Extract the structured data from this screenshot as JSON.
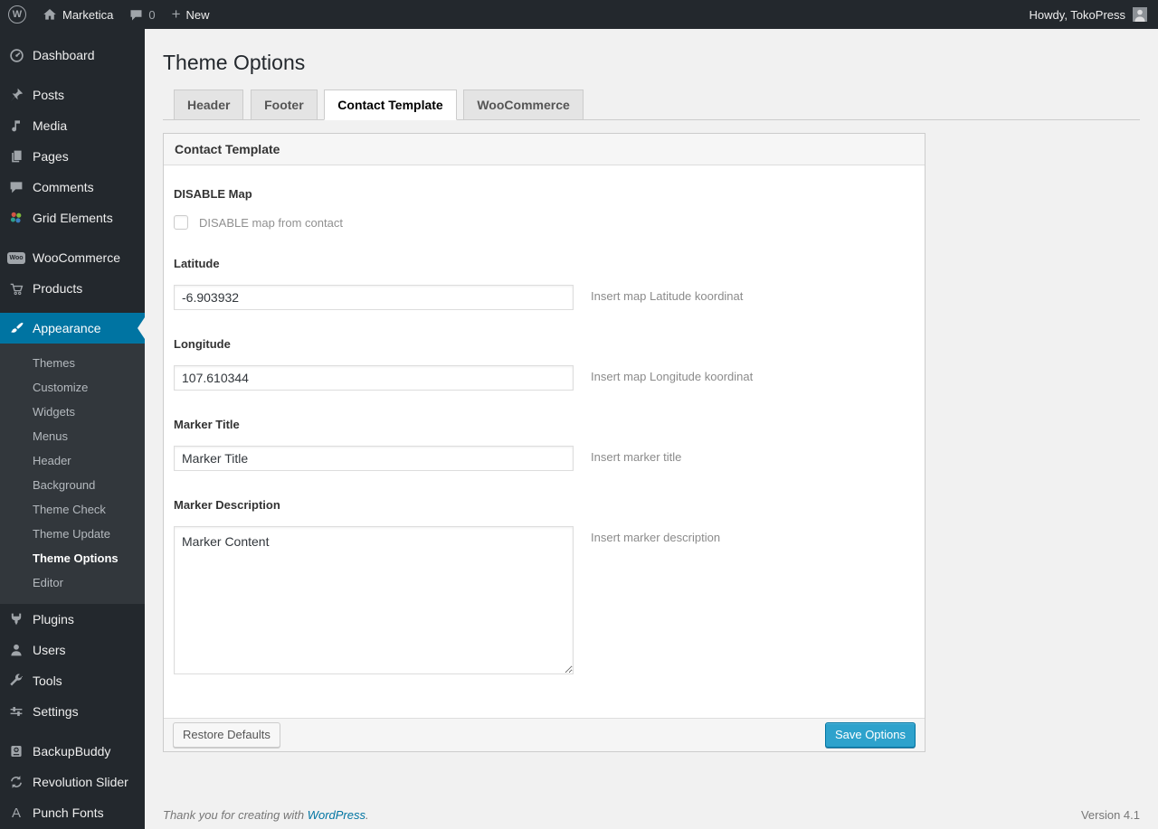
{
  "admin_bar": {
    "site_name": "Marketica",
    "comment_count": "0",
    "new_label": "New",
    "howdy": "Howdy, TokoPress"
  },
  "icons": {
    "wordpress_logo_letter": "W",
    "new_plus": "+",
    "woocommerce_badge": "Woo",
    "punch_fonts_letter": "A"
  },
  "sidebar": {
    "items": [
      {
        "label": "Dashboard"
      },
      {
        "label": "Posts"
      },
      {
        "label": "Media"
      },
      {
        "label": "Pages"
      },
      {
        "label": "Comments"
      },
      {
        "label": "Grid Elements"
      },
      {
        "label": "WooCommerce"
      },
      {
        "label": "Products"
      },
      {
        "label": "Appearance"
      },
      {
        "label": "Plugins"
      },
      {
        "label": "Users"
      },
      {
        "label": "Tools"
      },
      {
        "label": "Settings"
      },
      {
        "label": "BackupBuddy"
      },
      {
        "label": "Revolution Slider"
      },
      {
        "label": "Punch Fonts"
      }
    ],
    "appearance_submenu": [
      "Themes",
      "Customize",
      "Widgets",
      "Menus",
      "Header",
      "Background",
      "Theme Check",
      "Theme Update",
      "Theme Options",
      "Editor"
    ],
    "current_item": "Appearance",
    "current_submenu_item": "Theme Options"
  },
  "page": {
    "title": "Theme Options",
    "tabs": [
      {
        "label": "Header",
        "active": false
      },
      {
        "label": "Footer",
        "active": false
      },
      {
        "label": "Contact Template",
        "active": true
      },
      {
        "label": "WooCommerce",
        "active": false
      }
    ],
    "panel": {
      "title": "Contact Template",
      "fields": {
        "disable_map": {
          "label": "DISABLE Map",
          "checkbox_label": "DISABLE map from contact",
          "checked": false
        },
        "latitude": {
          "label": "Latitude",
          "value": "-6.903932",
          "hint": "Insert map Latitude koordinat"
        },
        "longitude": {
          "label": "Longitude",
          "value": "107.610344",
          "hint": "Insert map Longitude koordinat"
        },
        "marker_title": {
          "label": "Marker Title",
          "value": "Marker Title",
          "hint": "Insert marker title"
        },
        "marker_description": {
          "label": "Marker Description",
          "value": "Marker Content",
          "hint": "Insert marker description"
        }
      },
      "restore_button": "Restore Defaults",
      "save_button": "Save Options"
    }
  },
  "footer": {
    "thanks_prefix": "Thank you for creating with ",
    "wordpress_link": "WordPress",
    "thanks_suffix": ".",
    "version": "Version 4.1"
  },
  "colors": {
    "admin_bar_bg": "#23282d",
    "sidebar_bg": "#23282d",
    "submenu_bg": "#32373c",
    "highlight_blue": "#0074a2",
    "primary_button_blue": "#2ea2cc",
    "link_blue": "#0074a2",
    "content_bg": "#f1f1f1"
  }
}
